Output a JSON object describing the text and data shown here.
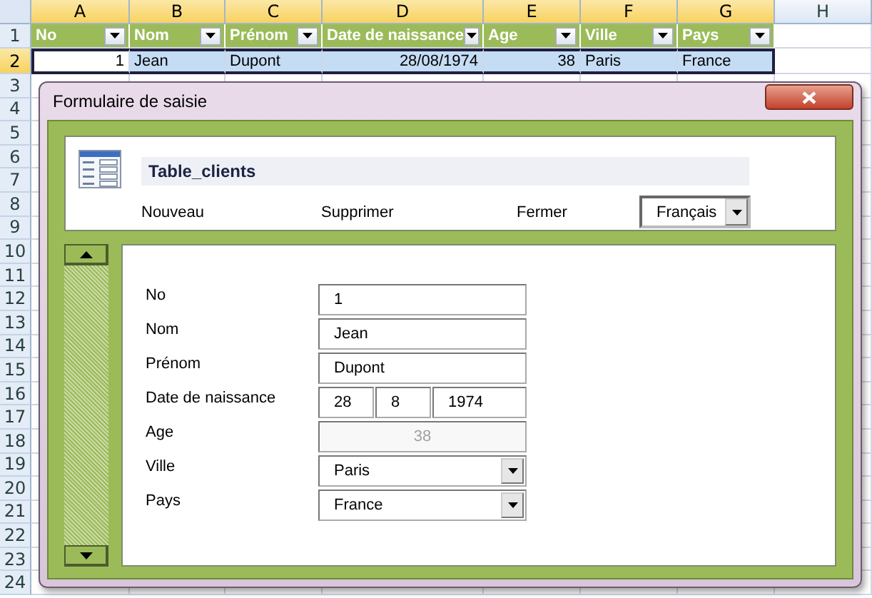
{
  "spreadsheet": {
    "columns": [
      {
        "label": "A",
        "selected": true
      },
      {
        "label": "B",
        "selected": true
      },
      {
        "label": "C",
        "selected": true
      },
      {
        "label": "D",
        "selected": true
      },
      {
        "label": "E",
        "selected": true
      },
      {
        "label": "F",
        "selected": true
      },
      {
        "label": "G",
        "selected": true
      },
      {
        "label": "H",
        "selected": false
      }
    ],
    "rows": [
      {
        "number": "1",
        "selected": false,
        "kind": "table-header",
        "cells": [
          {
            "text": "No"
          },
          {
            "text": "Nom"
          },
          {
            "text": "Prénom"
          },
          {
            "text": "Date de naissance"
          },
          {
            "text": "Age"
          },
          {
            "text": "Ville"
          },
          {
            "text": "Pays"
          }
        ]
      },
      {
        "number": "2",
        "selected": true,
        "kind": "data",
        "cells": [
          {
            "text": "1",
            "kind": "number"
          },
          {
            "text": "Jean",
            "kind": "text"
          },
          {
            "text": "Dupont",
            "kind": "text"
          },
          {
            "text": "28/08/1974",
            "kind": "number"
          },
          {
            "text": "38",
            "kind": "number"
          },
          {
            "text": "Paris",
            "kind": "text"
          },
          {
            "text": "France",
            "kind": "text"
          }
        ]
      },
      {
        "number": "3",
        "selected": false
      },
      {
        "number": "4",
        "selected": false
      },
      {
        "number": "5",
        "selected": false
      },
      {
        "number": "6",
        "selected": false
      },
      {
        "number": "7",
        "selected": false
      },
      {
        "number": "8",
        "selected": false
      },
      {
        "number": "9",
        "selected": false
      },
      {
        "number": "10",
        "selected": false
      },
      {
        "number": "11",
        "selected": false
      },
      {
        "number": "12",
        "selected": false
      },
      {
        "number": "13",
        "selected": false
      },
      {
        "number": "14",
        "selected": false
      },
      {
        "number": "15",
        "selected": false
      },
      {
        "number": "16",
        "selected": false
      },
      {
        "number": "17",
        "selected": false
      },
      {
        "number": "18",
        "selected": false
      },
      {
        "number": "19",
        "selected": false
      },
      {
        "number": "20",
        "selected": false
      },
      {
        "number": "21",
        "selected": false
      },
      {
        "number": "22",
        "selected": false
      },
      {
        "number": "23",
        "selected": false
      },
      {
        "number": "24",
        "selected": false
      }
    ]
  },
  "dialog": {
    "title": "Formulaire de saisie",
    "table_name": "Table_clients",
    "actions": [
      "Nouveau",
      "Supprimer",
      "Fermer"
    ],
    "language": "Français",
    "fields": [
      {
        "label": "No",
        "kind": "text",
        "value": "1",
        "disabled": false
      },
      {
        "label": "Nom",
        "kind": "text",
        "value": "Jean",
        "disabled": false
      },
      {
        "label": "Prénom",
        "kind": "text",
        "value": "Dupont",
        "disabled": false
      },
      {
        "label": "Date de naissance",
        "kind": "date",
        "parts": [
          "28",
          "8",
          "1974"
        ],
        "disabled": false
      },
      {
        "label": "Age",
        "kind": "text",
        "value": "38",
        "disabled": true
      },
      {
        "label": "Ville",
        "kind": "select",
        "value": "Paris",
        "disabled": false
      },
      {
        "label": "Pays",
        "kind": "select",
        "value": "France",
        "disabled": false
      }
    ]
  }
}
